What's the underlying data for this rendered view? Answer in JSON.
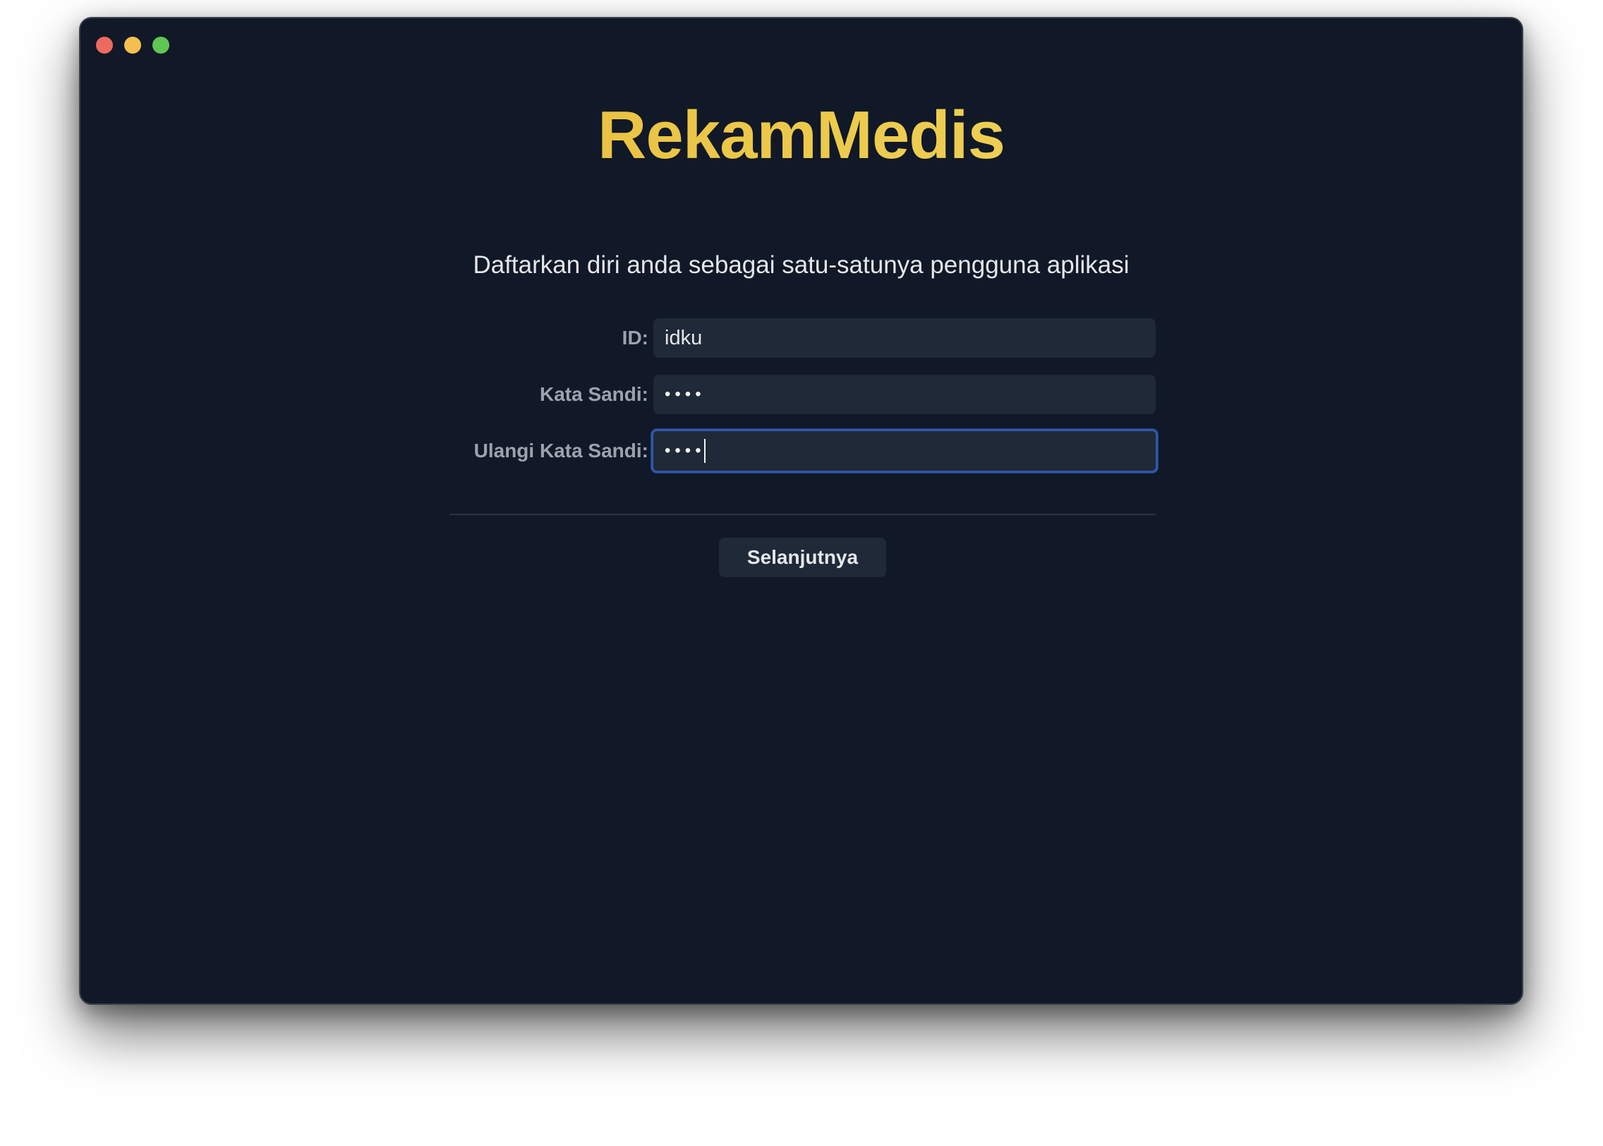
{
  "app": {
    "title": "RekamMedis",
    "subtitle": "Daftarkan diri anda sebagai satu-satunya pengguna aplikasi"
  },
  "window_controls": {
    "close_color": "#ed6a5e",
    "minimize_color": "#f5bf4f",
    "maximize_color": "#61c554"
  },
  "form": {
    "id": {
      "label": "ID:",
      "value": "idku"
    },
    "password": {
      "label": "Kata Sandi:",
      "value": "••••"
    },
    "confirm_password": {
      "label": "Ulangi Kata Sandi:",
      "value": "••••"
    }
  },
  "actions": {
    "next_label": "Selanjutnya"
  },
  "colors": {
    "background": "#111827",
    "title_accent": "#ecc94b",
    "field_bg": "#1f2937",
    "focus_ring": "#3158a8"
  }
}
